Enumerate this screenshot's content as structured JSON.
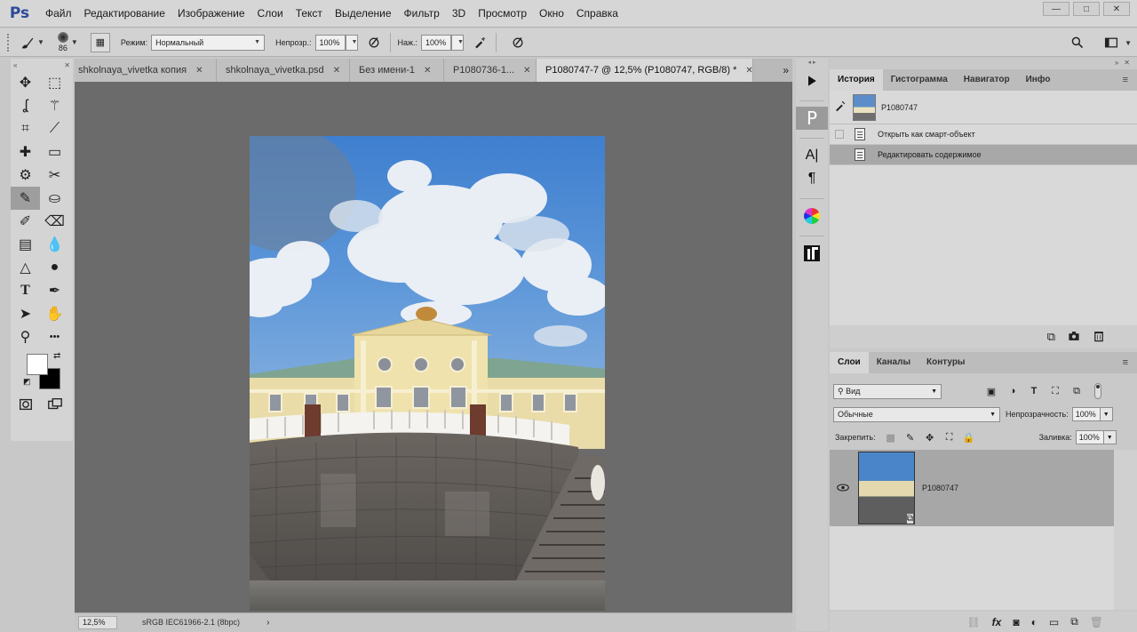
{
  "app": {
    "logo": "Ps",
    "menu": [
      "Файл",
      "Редактирование",
      "Изображение",
      "Слои",
      "Текст",
      "Выделение",
      "Фильтр",
      "3D",
      "Просмотр",
      "Окно",
      "Справка"
    ],
    "window_controls": [
      "—",
      "□",
      "✕"
    ]
  },
  "options": {
    "brush_size": "86",
    "mode_label": "Режим:",
    "mode_value": "Нормальный",
    "opacity_label": "Непрозр.:",
    "opacity_value": "100%",
    "flow_label": "Наж.:",
    "flow_value": "100%"
  },
  "tools": [
    [
      "move-icon",
      "marquee-icon"
    ],
    [
      "lasso-icon",
      "magic-wand-icon"
    ],
    [
      "crop-icon",
      "eyedropper-icon"
    ],
    [
      "healing-brush-icon",
      "bandage-icon"
    ],
    [
      "content-aware-icon",
      "content-move-icon"
    ],
    [
      "brush-icon",
      "stamp-icon"
    ],
    [
      "history-brush-icon",
      "eraser-icon"
    ],
    [
      "gradient-icon",
      "blur-drop-icon"
    ],
    [
      "dodge-icon",
      "burn-icon"
    ],
    [
      "type-icon",
      "pen-icon"
    ],
    [
      "path-select-icon",
      "hand-icon"
    ],
    [
      "zoom-icon",
      "more-tools-icon"
    ]
  ],
  "colors": {
    "foreground": "#ffffff",
    "background": "#000000"
  },
  "tabs": [
    {
      "label": "shkolnaya_vivetka копия",
      "close": "✕"
    },
    {
      "label": "shkolnaya_vivetka.psd",
      "close": "✕"
    },
    {
      "label": "Без имени-1",
      "close": "✕"
    },
    {
      "label": "P1080736-1...",
      "close": "✕"
    },
    {
      "label": "P1080747-7 @ 12,5% (P1080747, RGB/8) *",
      "close": "✕"
    }
  ],
  "tab_overflow": "»",
  "status": {
    "zoom": "12,5%",
    "profile": "sRGB IEC61966-2.1 (8bpc)",
    "arrow": "›"
  },
  "history_panel": {
    "tabs": [
      "История",
      "Гистограмма",
      "Навигатор",
      "Инфо"
    ],
    "snapshot": "P1080747",
    "items": [
      "Открыть как смарт-объект",
      "Редактировать содержимое"
    ]
  },
  "layers_panel": {
    "tabs": [
      "Слои",
      "Каналы",
      "Контуры"
    ],
    "filter": "Вид",
    "blend_mode": "Обычные",
    "opacity_label": "Непрозрачность:",
    "opacity_value": "100%",
    "lock_label": "Закрепить:",
    "fill_label": "Заливка:",
    "fill_value": "100%",
    "layer_name": "P1080747"
  }
}
